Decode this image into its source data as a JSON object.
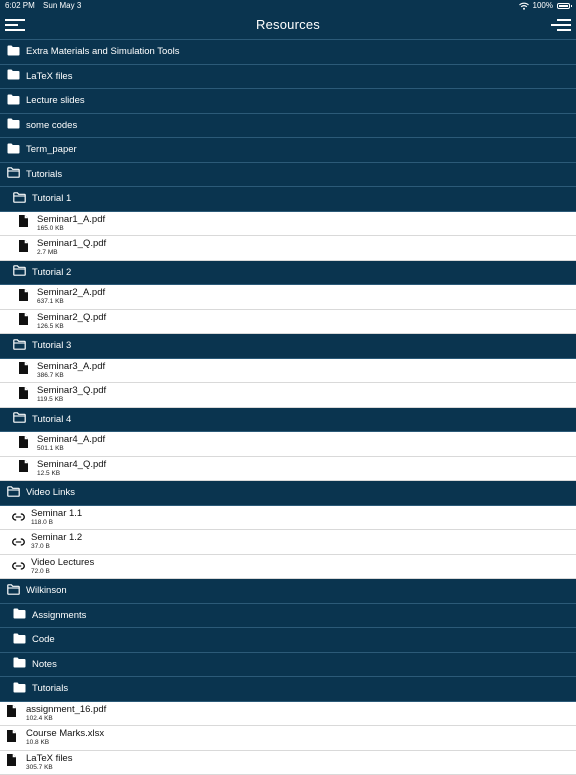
{
  "status": {
    "time": "6:02 PM",
    "date": "Sun May 3",
    "battery": "100%"
  },
  "nav": {
    "title": "Resources"
  },
  "rows": [
    {
      "kind": "folder",
      "level": 0,
      "label": "Extra Materials and Simulation Tools",
      "open": false,
      "icon": "folder-icon"
    },
    {
      "kind": "folder",
      "level": 0,
      "label": "LaTeX files",
      "open": false,
      "icon": "folder-icon"
    },
    {
      "kind": "folder",
      "level": 0,
      "label": "Lecture slides",
      "open": false,
      "icon": "folder-icon"
    },
    {
      "kind": "folder",
      "level": 0,
      "label": "some codes",
      "open": false,
      "icon": "folder-icon"
    },
    {
      "kind": "folder",
      "level": 0,
      "label": "Term_paper",
      "open": false,
      "icon": "folder-icon"
    },
    {
      "kind": "folder",
      "level": 0,
      "label": "Tutorials",
      "open": true,
      "icon": "folder-open-icon"
    },
    {
      "kind": "folder",
      "level": 1,
      "label": "Tutorial 1",
      "open": true,
      "icon": "folder-open-icon"
    },
    {
      "kind": "file",
      "level": 2,
      "label": "Seminar1_A.pdf",
      "size": "165.0 KB",
      "icon": "file-icon"
    },
    {
      "kind": "file",
      "level": 2,
      "label": "Seminar1_Q.pdf",
      "size": "2.7 MB",
      "icon": "file-icon"
    },
    {
      "kind": "folder",
      "level": 1,
      "label": "Tutorial 2",
      "open": true,
      "icon": "folder-open-icon"
    },
    {
      "kind": "file",
      "level": 2,
      "label": "Seminar2_A.pdf",
      "size": "637.1 KB",
      "icon": "file-icon"
    },
    {
      "kind": "file",
      "level": 2,
      "label": "Seminar2_Q.pdf",
      "size": "126.5 KB",
      "icon": "file-icon"
    },
    {
      "kind": "folder",
      "level": 1,
      "label": "Tutorial 3",
      "open": true,
      "icon": "folder-open-icon"
    },
    {
      "kind": "file",
      "level": 2,
      "label": "Seminar3_A.pdf",
      "size": "386.7 KB",
      "icon": "file-icon"
    },
    {
      "kind": "file",
      "level": 2,
      "label": "Seminar3_Q.pdf",
      "size": "119.5 KB",
      "icon": "file-icon"
    },
    {
      "kind": "folder",
      "level": 1,
      "label": "Tutorial 4",
      "open": true,
      "icon": "folder-open-icon"
    },
    {
      "kind": "file",
      "level": 2,
      "label": "Seminar4_A.pdf",
      "size": "501.1 KB",
      "icon": "file-icon"
    },
    {
      "kind": "file",
      "level": 2,
      "label": "Seminar4_Q.pdf",
      "size": "12.5 KB",
      "icon": "file-icon"
    },
    {
      "kind": "folder",
      "level": 0,
      "label": "Video Links",
      "open": true,
      "icon": "folder-open-icon"
    },
    {
      "kind": "link",
      "level": 1,
      "label": "Seminar 1.1",
      "size": "118.0 B",
      "icon": "link-icon"
    },
    {
      "kind": "link",
      "level": 1,
      "label": "Seminar 1.2",
      "size": "37.0 B",
      "icon": "link-icon"
    },
    {
      "kind": "link",
      "level": 1,
      "label": "Video Lectures",
      "size": "72.0 B",
      "icon": "link-icon"
    },
    {
      "kind": "folder",
      "level": 0,
      "label": "Wilkinson",
      "open": true,
      "icon": "folder-open-icon"
    },
    {
      "kind": "folder",
      "level": 1,
      "label": "Assignments",
      "open": false,
      "icon": "folder-icon"
    },
    {
      "kind": "folder",
      "level": 1,
      "label": "Code",
      "open": false,
      "icon": "folder-icon"
    },
    {
      "kind": "folder",
      "level": 1,
      "label": "Notes",
      "open": false,
      "icon": "folder-icon"
    },
    {
      "kind": "folder",
      "level": 1,
      "label": "Tutorials",
      "open": false,
      "icon": "folder-icon"
    },
    {
      "kind": "file",
      "level": 0,
      "label": "assignment_16.pdf",
      "size": "102.4 KB",
      "icon": "file-icon"
    },
    {
      "kind": "file",
      "level": 0,
      "label": "Course Marks.xlsx",
      "size": "10.8 KB",
      "icon": "file-icon"
    },
    {
      "kind": "file",
      "level": 0,
      "label": "LaTeX files",
      "size": "305.7 KB",
      "icon": "file-icon"
    }
  ]
}
